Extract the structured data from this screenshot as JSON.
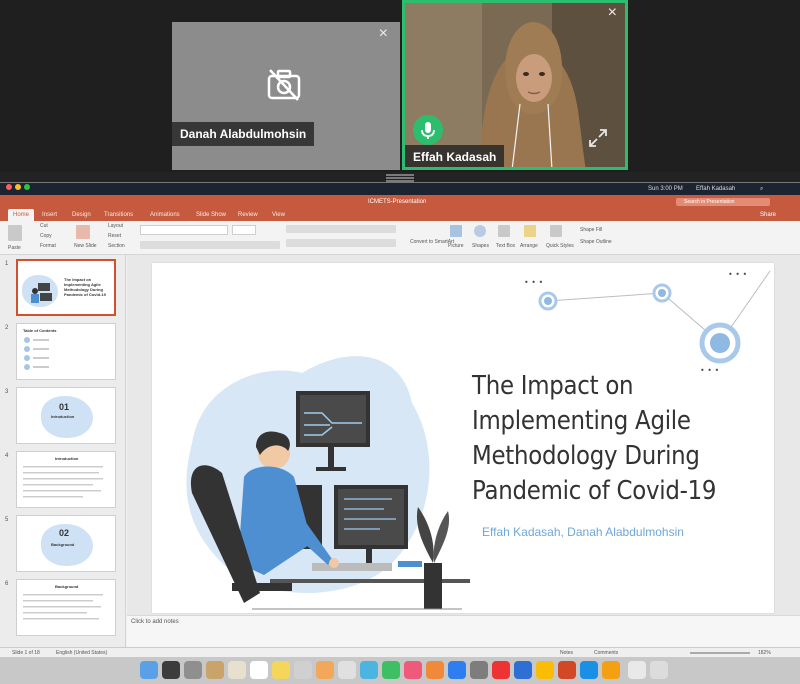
{
  "call": {
    "participants": [
      {
        "name": "Danah Alabdulmohsin",
        "video": "camera-off-icon"
      },
      {
        "name": "Effah  Kadasah",
        "video": "on",
        "speaking": true
      }
    ],
    "close_symbol": "×"
  },
  "menubar": {
    "clock": "Sun 3:00 PM",
    "user": "Effah Kadasah"
  },
  "window": {
    "title": "ICMETS-Presentation",
    "search_placeholder": "Search in Presentation",
    "share": "Share"
  },
  "ribbon": {
    "tabs": [
      "Home",
      "Insert",
      "Design",
      "Transitions",
      "Animations",
      "Slide Show",
      "Review",
      "View"
    ],
    "active_tab": "Home",
    "paste": "Paste",
    "cut": "Cut",
    "copy": "Copy",
    "format": "Format",
    "new_slide": "New Slide",
    "layout": "Layout",
    "reset": "Reset",
    "section": "Section",
    "convert_smartart": "Convert to SmartArt",
    "picture": "Picture",
    "shapes": "Shapes",
    "text_box": "Text Box",
    "arrange": "Arrange",
    "quick_styles": "Quick Styles",
    "shape_fill": "Shape Fill",
    "shape_outline": "Shape Outline"
  },
  "thumbnails": [
    {
      "num": "1",
      "text": "The Impact on Implementing Agile Methodology During Pandemic of Covid-19"
    },
    {
      "num": "2",
      "text": "Table of Contents"
    },
    {
      "num": "3",
      "text": "01",
      "sub": "Introduction"
    },
    {
      "num": "4",
      "text": "Introduction"
    },
    {
      "num": "5",
      "text": "02",
      "sub": "Background"
    },
    {
      "num": "6",
      "text": "Background"
    }
  ],
  "slide": {
    "title": "The Impact on\nImplementing Agile\nMethodology During\nPandemic of Covid-19",
    "authors": "Effah Kadasah, Danah Alabdulmohsin"
  },
  "notes_placeholder": "Click to add notes",
  "status": {
    "slide_counter": "Slide 1 of 18",
    "language": "English (United States)",
    "notes": "Notes",
    "comments": "Comments",
    "zoom": "182%"
  },
  "colors": {
    "ppt_accent": "#c65a3f",
    "speaking": "#2dbd6e",
    "slide_blue": "#6ea7d9"
  }
}
